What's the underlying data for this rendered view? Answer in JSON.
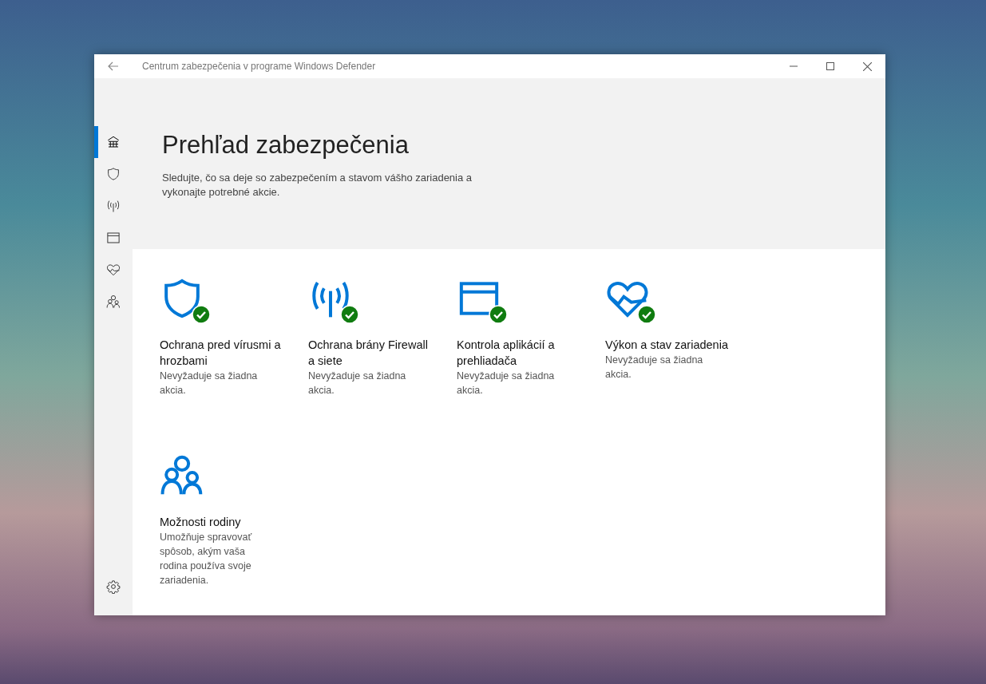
{
  "window": {
    "title": "Centrum zabezpečenia v programe Windows Defender"
  },
  "sidebar": {
    "items": [
      {
        "kind": "home",
        "selected": true
      },
      {
        "kind": "shield",
        "selected": false
      },
      {
        "kind": "antenna",
        "selected": false
      },
      {
        "kind": "browser",
        "selected": false
      },
      {
        "kind": "heart",
        "selected": false
      },
      {
        "kind": "family",
        "selected": false
      }
    ]
  },
  "header": {
    "title": "Prehľad zabezpečenia",
    "description": "Sledujte, čo sa deje so zabezpečením a stavom vášho zariadenia a vykonajte potrebné akcie."
  },
  "tiles": [
    {
      "kind": "shield",
      "ok": true,
      "title": "Ochrana pred vírusmi a hrozbami",
      "description": "Nevyžaduje sa žiadna akcia."
    },
    {
      "kind": "antenna",
      "ok": true,
      "title": "Ochrana brány Firewall a siete",
      "description": "Nevyžaduje sa žiadna akcia."
    },
    {
      "kind": "browser",
      "ok": true,
      "title": "Kontrola aplikácií a prehliadača",
      "description": "Nevyžaduje sa žiadna akcia."
    },
    {
      "kind": "heart",
      "ok": true,
      "title": "Výkon a stav zariadenia",
      "description": "Nevyžaduje sa žiadna akcia."
    },
    {
      "kind": "family",
      "ok": false,
      "title": "Možnosti rodiny",
      "description": "Umožňuje spravovať spôsob, akým vaša rodina používa svoje zariadenia."
    }
  ]
}
